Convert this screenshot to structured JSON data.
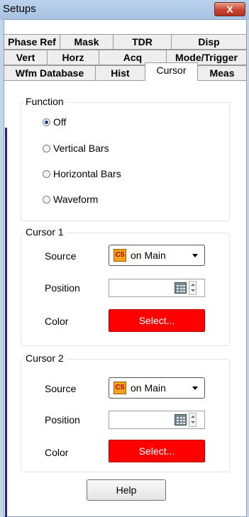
{
  "window": {
    "title": "Setups",
    "close_label": "X"
  },
  "tabs": {
    "row1": [
      "Phase Ref",
      "Mask",
      "TDR",
      "Disp"
    ],
    "row2": [
      "Vert",
      "Horz",
      "Acq",
      "Mode/Trigger"
    ],
    "row3": [
      "Wfm Database",
      "Hist",
      "Cursor",
      "Meas"
    ],
    "active": "Cursor"
  },
  "function": {
    "label": "Function",
    "options": [
      "Off",
      "Vertical Bars",
      "Horizontal Bars",
      "Waveform"
    ],
    "selected": "Off"
  },
  "cursor1": {
    "label": "Cursor 1",
    "source_label": "Source",
    "source_badge": "C5",
    "source_value": "on Main",
    "position_label": "Position",
    "position_value": "",
    "color_label": "Color",
    "color_button": "Select...",
    "color_value": "#ff0000"
  },
  "cursor2": {
    "label": "Cursor 2",
    "source_label": "Source",
    "source_badge": "C5",
    "source_value": "on Main",
    "position_label": "Position",
    "position_value": "",
    "color_label": "Color",
    "color_button": "Select...",
    "color_value": "#ff0000"
  },
  "help_button": "Help",
  "icons": {
    "close": "close-icon",
    "calculator": "calculator-icon",
    "dropdown": "chevron-down-icon",
    "spinner": "spinner-icon"
  }
}
